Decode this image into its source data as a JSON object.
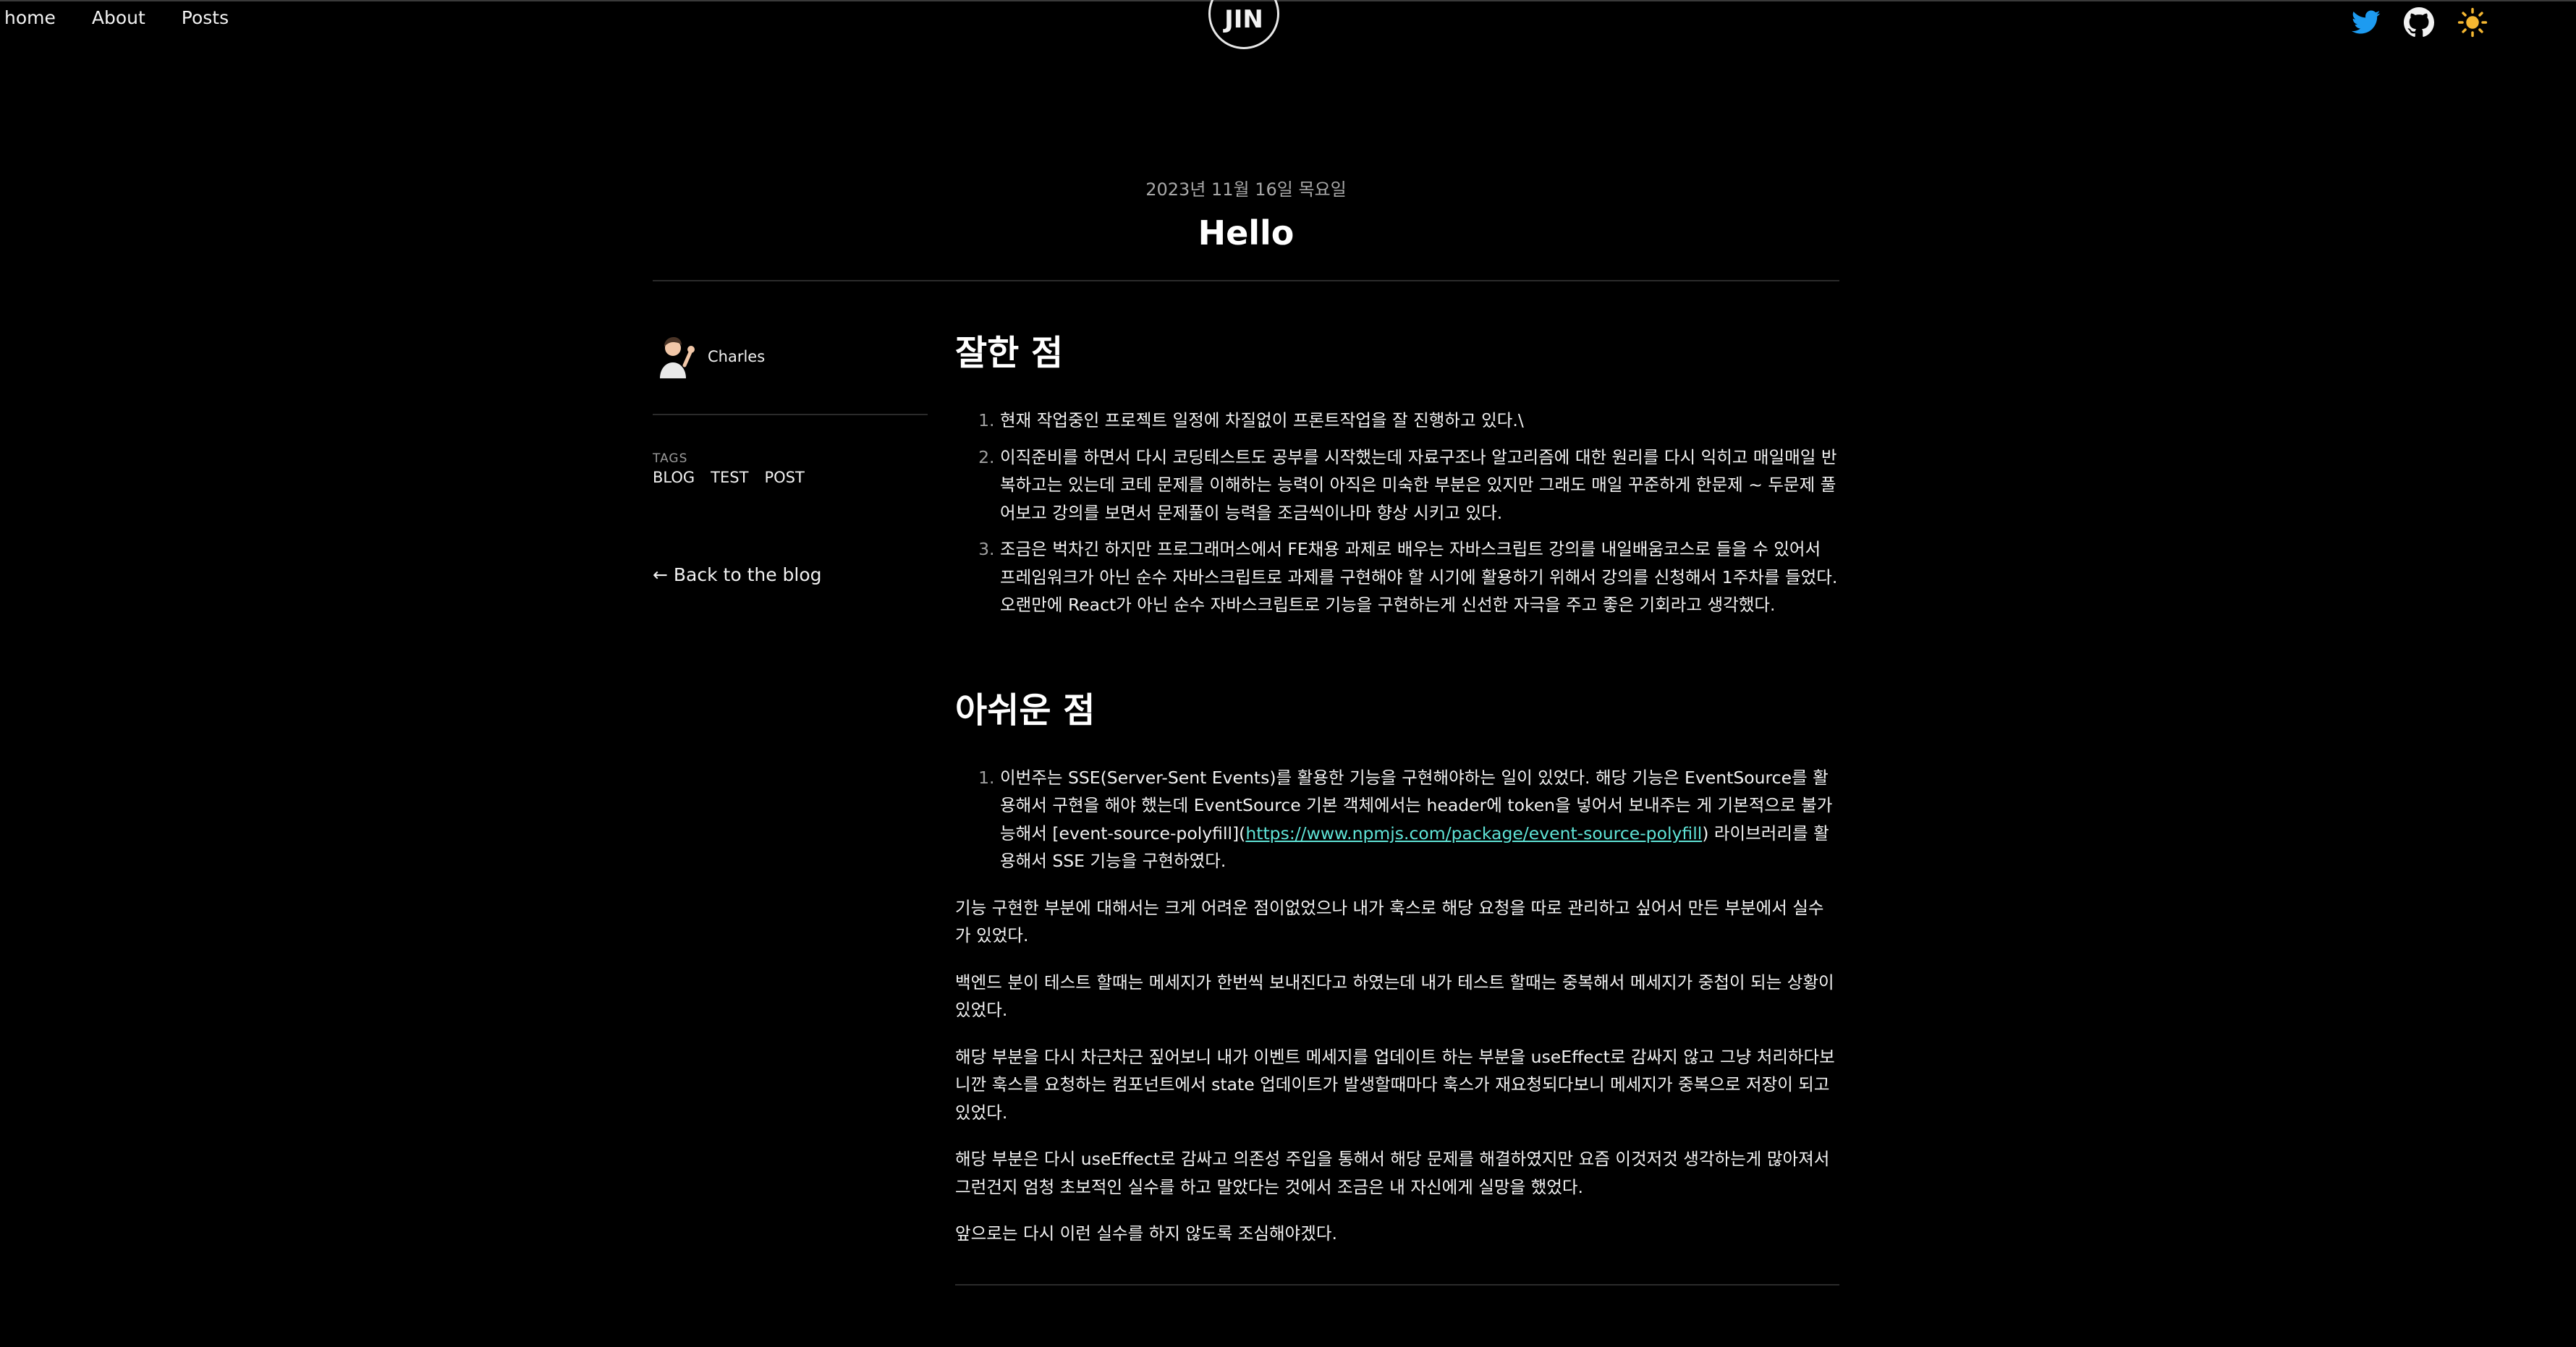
{
  "nav": {
    "home": "home",
    "about": "About",
    "posts": "Posts"
  },
  "logo": "JIN",
  "icons": {
    "twitter": "twitter-icon",
    "github": "github-icon",
    "theme": "sun-icon"
  },
  "colors": {
    "background": "#000000",
    "text": "#f2f2f2",
    "twitter": "#1d9bf0",
    "sun": "#f5b731",
    "link": "#5fe3d6"
  },
  "post": {
    "date": "2023년 11월 16일 목요일",
    "title": "Hello"
  },
  "sidebar": {
    "author": "Charles",
    "tags_label": "TAGS",
    "tags": [
      "BLOG",
      "TEST",
      "POST"
    ],
    "back": "← Back to the blog"
  },
  "content": {
    "heading1": "잘한 점",
    "list1": [
      "현재 작업중인 프로젝트 일정에 차질없이 프론트작업을 잘 진행하고 있다.\\",
      "이직준비를 하면서 다시 코딩테스트도 공부를 시작했는데 자료구조나 알고리즘에 대한 원리를 다시 익히고 매일매일 반복하고는 있는데 코테 문제를 이해하는 능력이 아직은 미숙한 부분은 있지만 그래도 매일 꾸준하게 한문제 ~ 두문제 풀어보고 강의를 보면서 문제풀이 능력을 조금씩이나마 향상 시키고 있다.",
      "조금은 벅차긴 하지만 프로그래머스에서 FE채용 과제로 배우는 자바스크립트 강의를 내일배움코스로 들을 수 있어서 프레임워크가 아닌 순수 자바스크립트로 과제를 구현해야 할 시기에 활용하기 위해서 강의를 신청해서 1주차를 들었다. 오랜만에 React가 아닌 순수 자바스크립트로 기능을 구현하는게 신선한 자극을 주고 좋은 기회라고 생각했다."
    ],
    "heading2": "아쉬운 점",
    "list2_before": "이번주는 SSE(Server-Sent Events)를 활용한 기능을 구현해야하는 일이 있었다. 해당 기능은 EventSource를 활용해서 구현을 해야 했는데 EventSource 기본 객체에서는 header에 token을 넣어서 보내주는 게 기본적으로 불가능해서 [event-source-polyfill](",
    "list2_link": "https://www.npmjs.com/package/event-source-polyfill",
    "list2_after": ") 라이브러리를 활용해서 SSE 기능을 구현하였다.",
    "paragraphs": [
      "기능 구현한 부분에 대해서는 크게 어려운 점이없었으나 내가 훅스로 해당 요청을 따로 관리하고 싶어서 만든 부분에서 실수가 있었다.",
      "백엔드 분이 테스트 할때는 메세지가 한번씩 보내진다고 하였는데 내가 테스트 할때는 중복해서 메세지가 중첩이 되는 상황이 있었다.",
      "해당 부분을 다시 차근차근 짚어보니 내가 이벤트 메세지를 업데이트 하는 부분을 useEffect로 감싸지 않고 그냥 처리하다보니깐 훅스를 요청하는 컴포넌트에서 state 업데이트가 발생할때마다 훅스가 재요청되다보니 메세지가 중복으로 저장이 되고 있었다.",
      "해당 부분은 다시 useEffect로 감싸고 의존성 주입을 통해서 해당 문제를 해결하였지만 요즘 이것저것 생각하는게 많아져서 그런건지 엄청 초보적인 실수를 하고 말았다는 것에서 조금은 내 자신에게 실망을 했었다.",
      "앞으로는 다시 이런 실수를 하지 않도록 조심해야겠다."
    ]
  }
}
